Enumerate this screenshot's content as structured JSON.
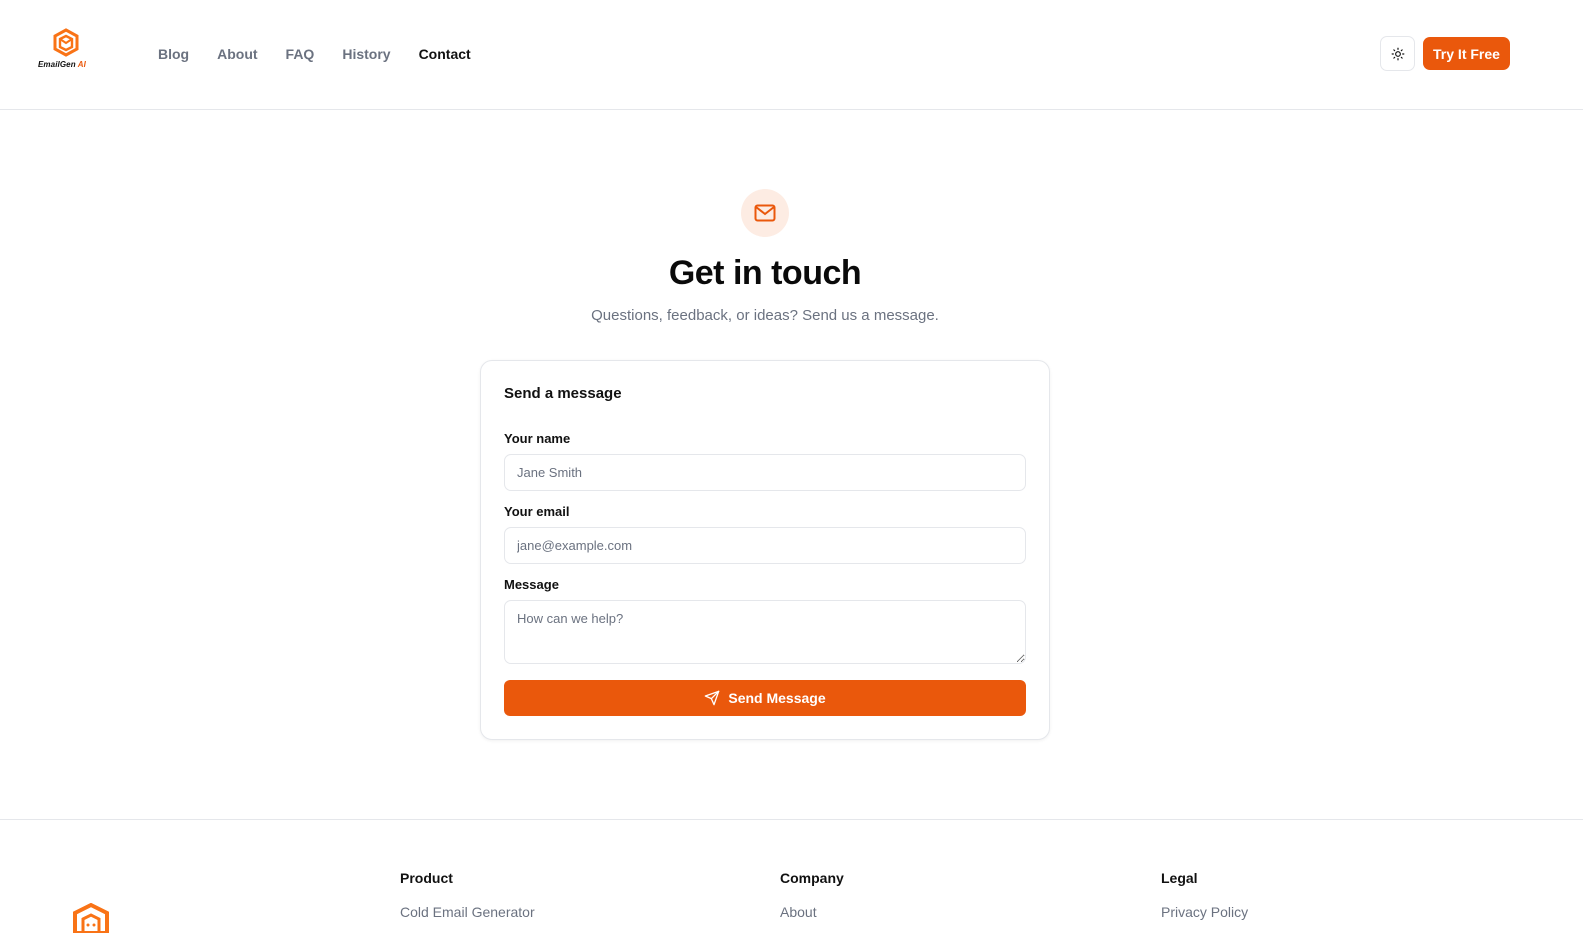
{
  "brand": {
    "name": "EmailGen",
    "suffix": "AI",
    "accent": "#ea580c",
    "logo_icon": "hexagon-envelope-logo"
  },
  "nav": {
    "items": [
      {
        "label": "Blog",
        "active": false
      },
      {
        "label": "About",
        "active": false
      },
      {
        "label": "FAQ",
        "active": false
      },
      {
        "label": "History",
        "active": false
      },
      {
        "label": "Contact",
        "active": true
      }
    ],
    "theme_icon": "sun-icon",
    "cta_label": "Try It Free"
  },
  "hero": {
    "icon": "mail-icon",
    "title": "Get in touch",
    "subtitle": "Questions, feedback, or ideas? Send us a message."
  },
  "form": {
    "title": "Send a message",
    "name_label": "Your name",
    "name_placeholder": "Jane Smith",
    "name_value": "",
    "email_label": "Your email",
    "email_placeholder": "jane@example.com",
    "email_value": "",
    "message_label": "Message",
    "message_placeholder": "How can we help?",
    "message_value": "",
    "submit_label": "Send Message",
    "submit_icon": "send-icon"
  },
  "footer": {
    "columns": [
      {
        "heading": "Product",
        "links": [
          "Cold Email Generator"
        ]
      },
      {
        "heading": "Company",
        "links": [
          "About"
        ]
      },
      {
        "heading": "Legal",
        "links": [
          "Privacy Policy"
        ]
      }
    ]
  }
}
